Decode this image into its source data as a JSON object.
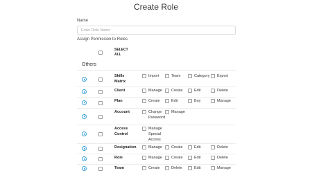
{
  "page": {
    "title": "Create Role",
    "name_label": "Name",
    "name_placeholder": "Enter Role Name",
    "assign_label": "Assign Permission to Roles",
    "select_all": "SELECT ALL",
    "section": "Others"
  },
  "colors": {
    "accent": "#3aa0d8",
    "border": "#dcdcdc"
  },
  "modules": [
    {
      "name": "Skills Matrix",
      "permissions": [
        "Import",
        "Team",
        "Category",
        "Export"
      ]
    },
    {
      "name": "Client",
      "permissions": [
        "Manage",
        "Create",
        "Edit",
        "Delete"
      ]
    },
    {
      "name": "Plan",
      "permissions": [
        "Create",
        "Edit",
        "Buy",
        "Manage"
      ]
    },
    {
      "name": "Account",
      "permissions": [
        "Change Password",
        "Manage"
      ]
    },
    {
      "name": "Access Control",
      "permissions": [
        "Manage Special Access"
      ]
    },
    {
      "name": "Designation",
      "permissions": [
        "Manage",
        "Create",
        "Edit",
        "Delete"
      ]
    },
    {
      "name": "Role",
      "permissions": [
        "Manage",
        "Create",
        "Edit",
        "Delete"
      ]
    },
    {
      "name": "Team",
      "permissions": [
        "Create",
        "Delete",
        "Edit",
        "Manage"
      ]
    }
  ]
}
